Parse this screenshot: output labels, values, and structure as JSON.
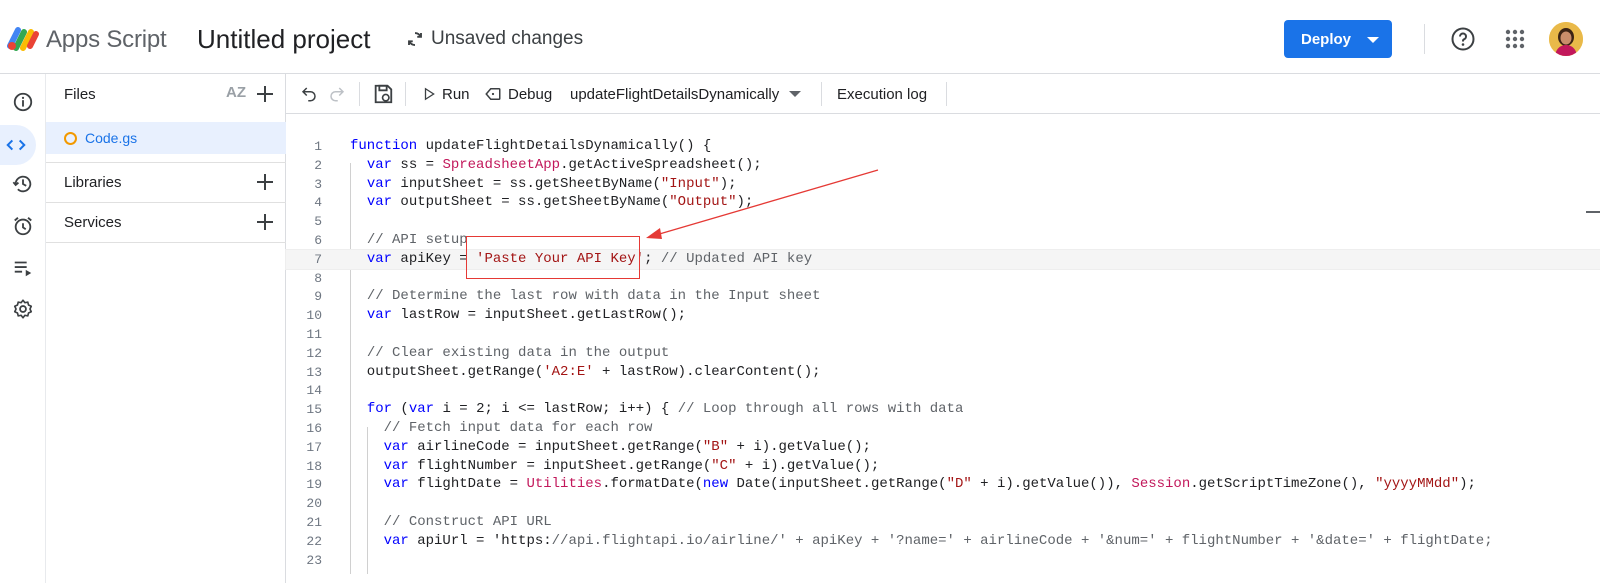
{
  "header": {
    "app_name": "Apps Script",
    "project_title": "Untitled project",
    "save_status": "Unsaved changes",
    "deploy_label": "Deploy"
  },
  "rail": {
    "items": [
      {
        "icon": "info-icon",
        "active": false
      },
      {
        "icon": "code-icon",
        "active": true
      },
      {
        "icon": "history-icon",
        "active": false
      },
      {
        "icon": "alarm-icon",
        "active": false
      },
      {
        "icon": "executions-icon",
        "active": false
      },
      {
        "icon": "gear-icon",
        "active": false
      }
    ]
  },
  "files_panel": {
    "files_label": "Files",
    "sort_label": "AZ",
    "file_name": "Code.gs",
    "libraries_label": "Libraries",
    "services_label": "Services"
  },
  "toolbar": {
    "run_label": "Run",
    "debug_label": "Debug",
    "function_name": "updateFlightDetailsDynamically",
    "execution_log_label": "Execution log"
  },
  "editor": {
    "line_numbers": [
      "1",
      "2",
      "3",
      "4",
      "5",
      "6",
      "7",
      "8",
      "9",
      "10",
      "11",
      "12",
      "13",
      "14",
      "15",
      "16",
      "17",
      "18",
      "19",
      "20",
      "21",
      "22",
      "23"
    ],
    "lines": [
      "function updateFlightDetailsDynamically() {",
      "  var ss = SpreadsheetApp.getActiveSpreadsheet();",
      "  var inputSheet = ss.getSheetByName(\"Input\");",
      "  var outputSheet = ss.getSheetByName(\"Output\");",
      "",
      "  // API setup",
      "  var apiKey = 'Paste Your API Key'; // Updated API key",
      "",
      "  // Determine the last row with data in the Input sheet",
      "  var lastRow = inputSheet.getLastRow();",
      "",
      "  // Clear existing data in the output",
      "  outputSheet.getRange('A2:E' + lastRow).clearContent();",
      "",
      "  for (var i = 2; i <= lastRow; i++) { // Loop through all rows with data",
      "    // Fetch input data for each row",
      "    var airlineCode = inputSheet.getRange(\"B\" + i).getValue();",
      "    var flightNumber = inputSheet.getRange(\"C\" + i).getValue();",
      "    var flightDate = Utilities.formatDate(new Date(inputSheet.getRange(\"D\" + i).getValue()), Session.getScriptTimeZone(), \"yyyyMMdd\");",
      "",
      "    // Construct API URL",
      "    var apiUrl = 'https://api.flightapi.io/airline/' + apiKey + '?name=' + airlineCode + '&num=' + flightNumber + '&date=' + flightDate;",
      ""
    ],
    "current_line": 7
  },
  "colors": {
    "accent": "#1a73e8",
    "annotation": "#e53935"
  }
}
